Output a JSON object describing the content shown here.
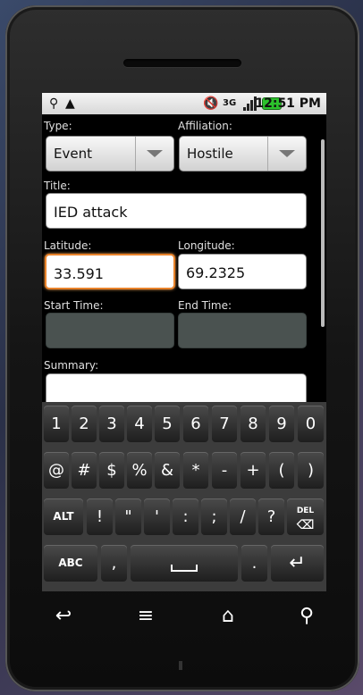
{
  "status_bar": {
    "time": "12:51 PM",
    "usb_icon": "usb-icon",
    "warning_icon": "warning-icon"
  },
  "form": {
    "type_label": "Type:",
    "type_value": "Event",
    "affiliation_label": "Affiliation:",
    "affiliation_value": "Hostile",
    "title_label": "Title:",
    "title_value": "IED attack",
    "latitude_label": "Latitude:",
    "latitude_value": "33.591",
    "longitude_label": "Longitude:",
    "longitude_value": "69.2325",
    "start_time_label": "Start Time:",
    "end_time_label": "End Time:",
    "summary_label": "Summary:"
  },
  "keyboard": {
    "row1": [
      "1",
      "2",
      "3",
      "4",
      "5",
      "6",
      "7",
      "8",
      "9",
      "0"
    ],
    "row2": [
      "@",
      "#",
      "$",
      "%",
      "&",
      "*",
      "-",
      "+",
      "(",
      ")"
    ],
    "row3_alt": "ALT",
    "row3": [
      "!",
      "\"",
      "'",
      ":",
      ";",
      "/",
      "?"
    ],
    "row3_del": "DEL",
    "row4_abc": "ABC",
    "row4_comma": ",",
    "row4_period": "."
  },
  "colors": {
    "focus": "#e8822a",
    "battery": "#2cc22c"
  }
}
